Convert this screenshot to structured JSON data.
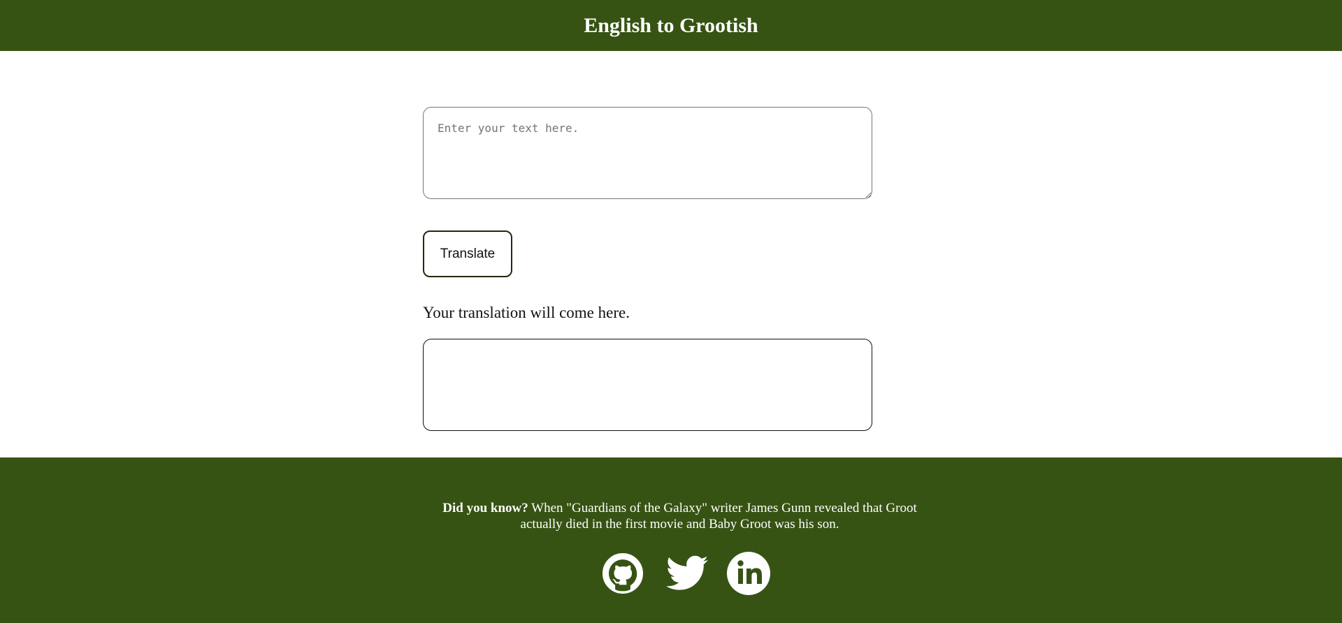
{
  "header": {
    "title": "English to Grootish"
  },
  "main": {
    "input": {
      "placeholder": "Enter your text here.",
      "value": ""
    },
    "translate_button": "Translate",
    "output_label": "Your translation will come here.",
    "output_value": ""
  },
  "footer": {
    "trivia_heading": "Did you know?",
    "trivia_text": " When \"Guardians of the Galaxy\" writer James Gunn revealed that Groot actually died in the first movie and Baby Groot was his son.",
    "social": [
      {
        "icon": "github-icon"
      },
      {
        "icon": "twitter-icon"
      },
      {
        "icon": "linkedin-icon"
      }
    ]
  },
  "colors": {
    "brand": "#365314",
    "text_on_brand": "#ffffff"
  }
}
